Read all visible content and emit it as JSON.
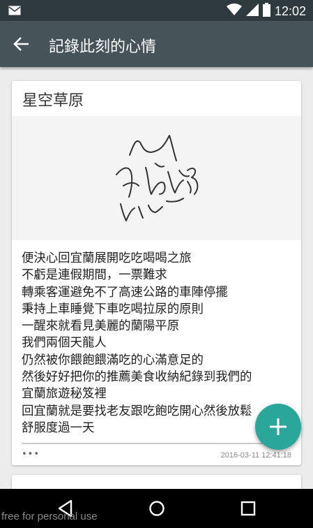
{
  "status_bar": {
    "time": "12:02",
    "icons": [
      "mail-icon",
      "wifi-icon",
      "signal-icon",
      "battery-icon"
    ]
  },
  "app_bar": {
    "title": "記錄此刻的心情",
    "back_icon": "arrow-left-icon"
  },
  "card": {
    "title": "星空草原",
    "body": "便決心回宜蘭展開吃吃喝喝之旅\n不虧是連假期間，一票難求\n轉乘客運避免不了高速公路的車陣停擺\n秉持上車睡覺下車吃喝拉尿的原則\n一醒來就看見美麗的蘭陽平原\n我們兩個天龍人\n仍然被你餵飽餵滿吃的心滿意足的\n然後好好把你的推薦美食收納紀錄到我們的\n宜蘭旅遊秘笈裡\n回宜蘭就是要找老友跟吃飽吃開心然後放鬆\n舒服度過一天",
    "more": "•••",
    "date": "2016-03-11 12:41:18"
  },
  "fab": {
    "icon": "plus-icon"
  },
  "nav_bar": {
    "icons": [
      "back-triangle-icon",
      "home-circle-icon",
      "recents-square-icon"
    ]
  },
  "watermark": "free for personal use",
  "colors": {
    "status_bar": "#2f3a3f",
    "app_bar": "#465359",
    "fab": "#2aa79a",
    "background": "#ececec"
  }
}
